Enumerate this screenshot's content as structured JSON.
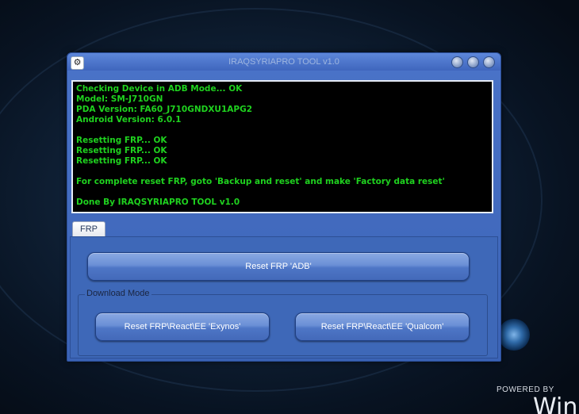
{
  "window": {
    "title": "IRAQSYRIAPRO TOOL v1.0",
    "app_icon": "gear-icon"
  },
  "console": {
    "lines": [
      "Checking Device in ADB Mode... OK",
      "Model: SM-J710GN",
      "PDA Version: FA60_J710GNDXU1APG2",
      "Android Version: 6.0.1",
      "",
      "Resetting FRP... OK",
      "Resetting FRP... OK",
      "Resetting FRP... OK",
      "",
      "For complete reset FRP, goto 'Backup and reset' and make 'Factory data reset'",
      "",
      "Done By IRAQSYRIAPRO TOOL v1.0"
    ],
    "text_color": "#1fd21f"
  },
  "tabs": [
    {
      "label": "FRP"
    }
  ],
  "buttons": {
    "reset_adb": "Reset FRP 'ADB'",
    "reset_exynos": "Reset FRP\\React\\EE 'Exynos'",
    "reset_qualcom": "Reset FRP\\React\\EE 'Qualcom'"
  },
  "download_group": {
    "label": "Download Mode"
  },
  "desktop": {
    "powered_by": "POWERED BY",
    "watermark": "Win"
  },
  "colors": {
    "window_blue": "#3e68b8",
    "console_bg": "#000000"
  }
}
